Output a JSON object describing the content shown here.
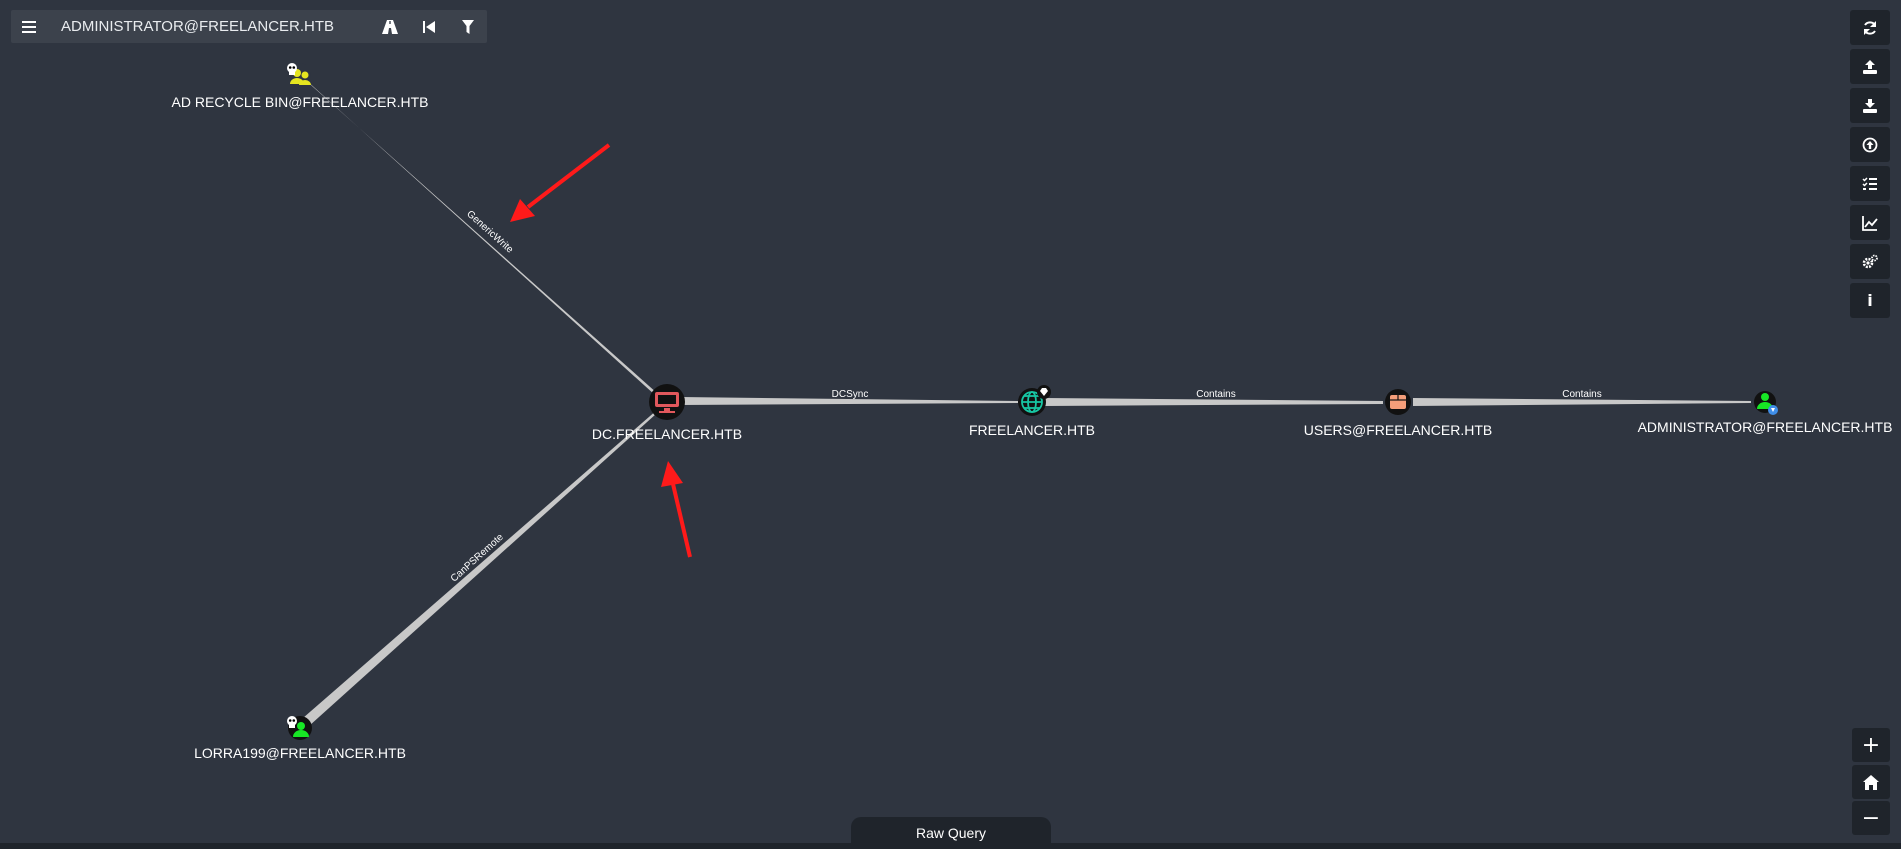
{
  "search": {
    "value": "ADMINISTRATOR@FREELANCER.HTB"
  },
  "toolbar_icons": [
    "menu-icon",
    "pathfinding-icon",
    "back-icon",
    "filter-icon"
  ],
  "right_toolbar": [
    "refresh-icon",
    "upload-icon",
    "download-icon",
    "upload-data-icon",
    "queries-icon",
    "stats-icon",
    "settings-icon",
    "info-icon"
  ],
  "zoom_controls": {
    "zoom_in": "+",
    "home": "home-icon",
    "zoom_out": "−"
  },
  "graph": {
    "nodes": {
      "ad_recycle": "AD RECYCLE BIN@FREELANCER.HTB",
      "dc": "DC.FREELANCER.HTB",
      "domain": "FREELANCER.HTB",
      "users": "USERS@FREELANCER.HTB",
      "administrator": "ADMINISTRATOR@FREELANCER.HTB",
      "lorra": "LORRA199@FREELANCER.HTB"
    },
    "edges": {
      "generic_write": "GenericWrite",
      "can_ps_remote": "CanPSRemote",
      "dcsync": "DCSync",
      "contains_1": "Contains",
      "contains_2": "Contains"
    }
  },
  "annotations": {
    "arrow_color": "#ff1a1a"
  },
  "raw_query": {
    "label": "Raw Query"
  },
  "colors": {
    "background": "#2f3540",
    "toolbar": "#1f242b",
    "edge": "#c8c8c8",
    "computer_node": "#e2585c",
    "ou_node": "#f59e7a",
    "group_node": "#e5e520",
    "user_node": "#17e625"
  }
}
